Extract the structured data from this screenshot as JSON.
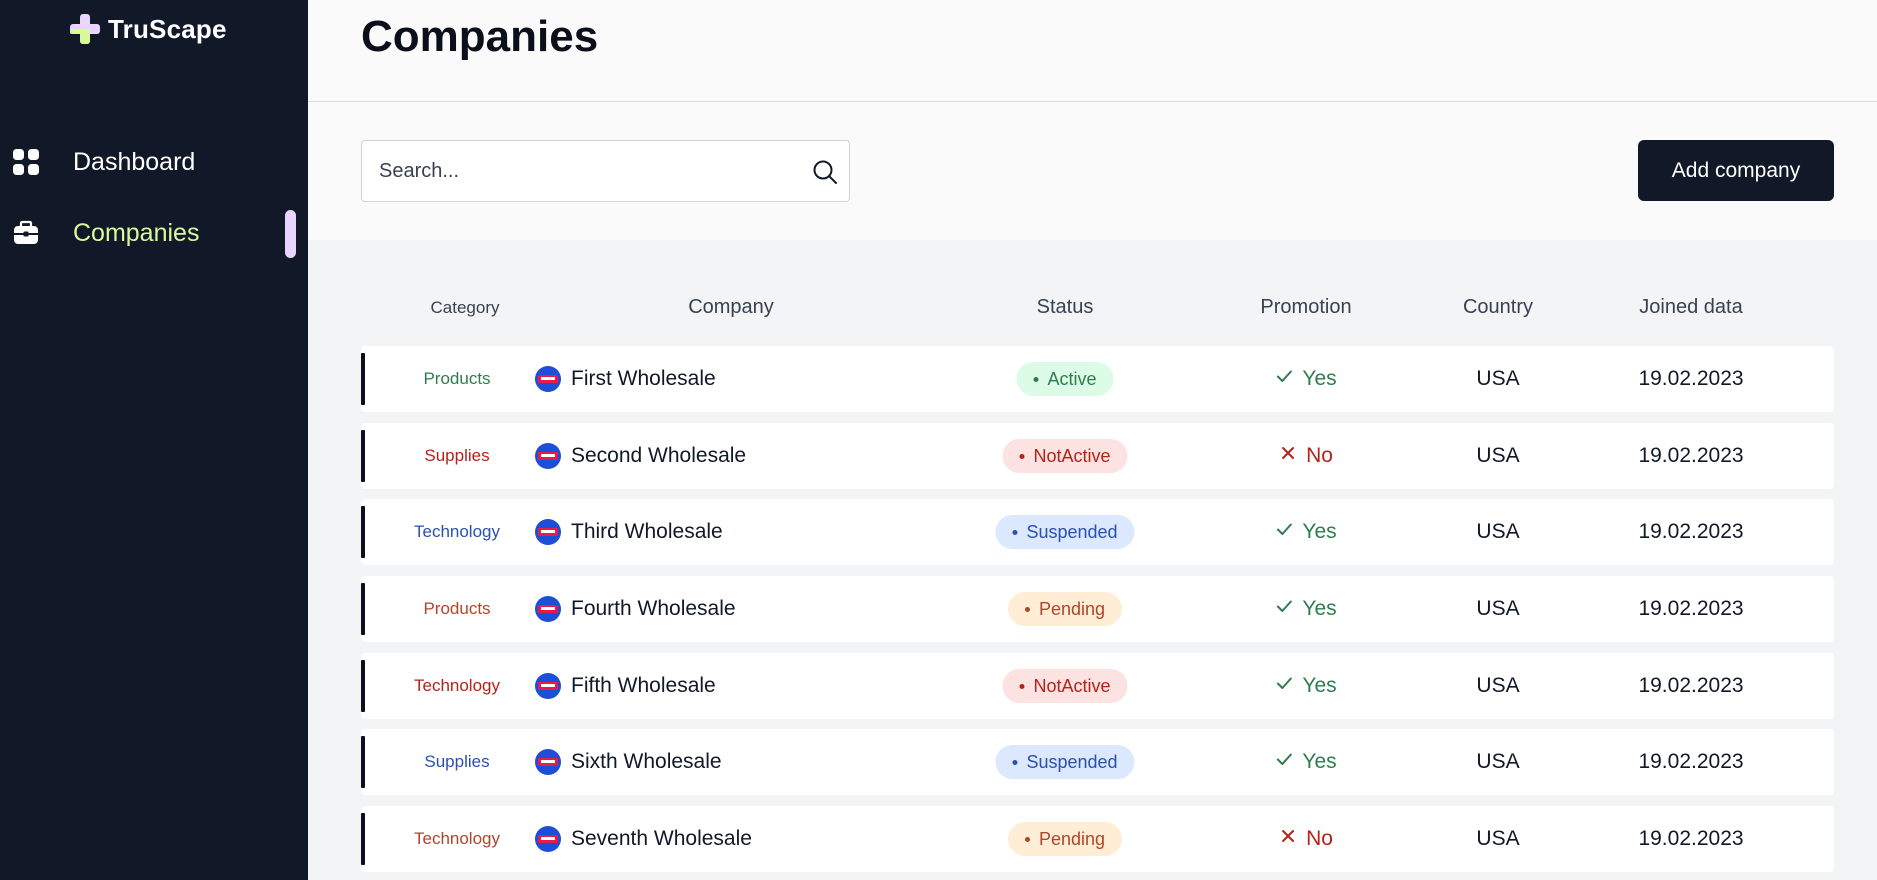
{
  "brand": {
    "name": "TruScape"
  },
  "nav": [
    {
      "label": "Dashboard",
      "icon": "grid-icon",
      "active": false
    },
    {
      "label": "Companies",
      "icon": "briefcase-icon",
      "active": true
    }
  ],
  "page": {
    "title": "Companies"
  },
  "search": {
    "placeholder": "Search...",
    "value": ""
  },
  "toolbar": {
    "add_label": "Add company"
  },
  "table": {
    "headers": {
      "category": "Category",
      "company": "Company",
      "status": "Status",
      "promotion": "Promotion",
      "country": "Country",
      "joined": "Joined data"
    },
    "rows": [
      {
        "category": "Products",
        "category_color": "#2f7d4e",
        "company": "First Wholesale",
        "status": "Active",
        "promotion": "Yes",
        "country": "USA",
        "joined": "19.02.2023"
      },
      {
        "category": "Supplies",
        "category_color": "#b42318",
        "company": "Second Wholesale",
        "status": "NotActive",
        "promotion": "No",
        "country": "USA",
        "joined": "19.02.2023"
      },
      {
        "category": "Technology",
        "category_color": "#2b50b0",
        "company": "Third Wholesale",
        "status": "Suspended",
        "promotion": "Yes",
        "country": "USA",
        "joined": "19.02.2023"
      },
      {
        "category": "Products",
        "category_color": "#b0452a",
        "company": "Fourth Wholesale",
        "status": "Pending",
        "promotion": "Yes",
        "country": "USA",
        "joined": "19.02.2023"
      },
      {
        "category": "Technology",
        "category_color": "#b42318",
        "company": "Fifth Wholesale",
        "status": "NotActive",
        "promotion": "Yes",
        "country": "USA",
        "joined": "19.02.2023"
      },
      {
        "category": "Supplies",
        "category_color": "#2b50b0",
        "company": "Sixth Wholesale",
        "status": "Suspended",
        "promotion": "Yes",
        "country": "USA",
        "joined": "19.02.2023"
      },
      {
        "category": "Technology",
        "category_color": "#b0452a",
        "company": "Seventh Wholesale",
        "status": "Pending",
        "promotion": "No",
        "country": "USA",
        "joined": "19.02.2023"
      }
    ]
  },
  "status_styles": {
    "Active": {
      "bg": "#dcfce7",
      "fg": "#2f7d4e"
    },
    "NotActive": {
      "bg": "#fde2e2",
      "fg": "#b42318"
    },
    "Suspended": {
      "bg": "#dbe8fd",
      "fg": "#2b50b0"
    },
    "Pending": {
      "bg": "#ffedd5",
      "fg": "#b0452a"
    }
  },
  "promotion_styles": {
    "Yes": {
      "fg": "#2f7d4e",
      "icon": "check-icon"
    },
    "No": {
      "fg": "#b42318",
      "icon": "x-icon"
    }
  },
  "colors": {
    "sidebar_bg": "#111827",
    "active_nav": "#d9f99d",
    "active_indicator": "#e9d5ff",
    "primary_button": "#111827"
  }
}
